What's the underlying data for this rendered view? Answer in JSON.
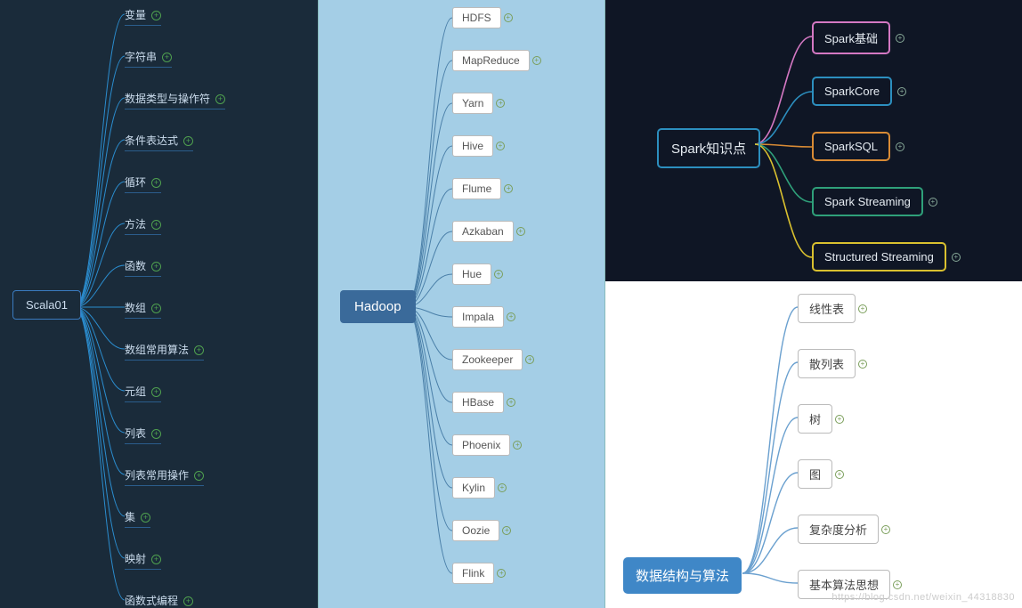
{
  "watermark": "https://blog.csdn.net/weixin_44318830",
  "scala": {
    "root": "Scala01",
    "items": [
      "变量",
      "字符串",
      "数据类型与操作符",
      "条件表达式",
      "循环",
      "方法",
      "函数",
      "数组",
      "数组常用算法",
      "元组",
      "列表",
      "列表常用操作",
      "集",
      "映射",
      "函数式编程"
    ]
  },
  "hadoop": {
    "root": "Hadoop",
    "items": [
      "HDFS",
      "MapReduce",
      "Yarn",
      "Hive",
      "Flume",
      "Azkaban",
      "Hue",
      "Impala",
      "Zookeeper",
      "HBase",
      "Phoenix",
      "Kylin",
      "Oozie",
      "Flink"
    ]
  },
  "spark": {
    "root": "Spark知识点",
    "items": [
      {
        "label": "Spark基础",
        "color": "#d478c3"
      },
      {
        "label": "SparkCore",
        "color": "#2c8fbf"
      },
      {
        "label": "SparkSQL",
        "color": "#d98b35"
      },
      {
        "label": "Spark Streaming",
        "color": "#2fa07a"
      },
      {
        "label": "Structured Streaming",
        "color": "#d9c02f"
      }
    ]
  },
  "ds": {
    "root": "数据结构与算法",
    "items": [
      "线性表",
      "散列表",
      "树",
      "图",
      "复杂度分析",
      "基本算法思想"
    ]
  }
}
